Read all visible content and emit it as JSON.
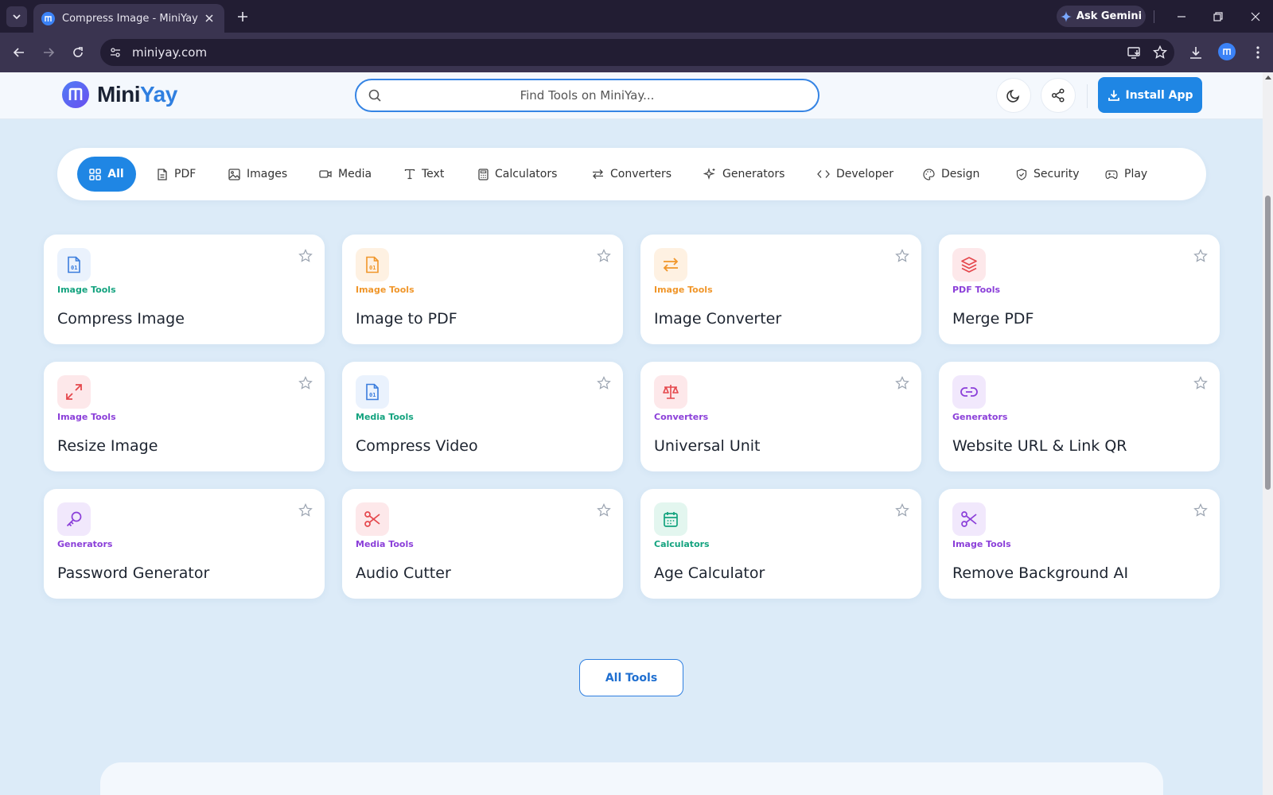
{
  "browser": {
    "tab_title": "Compress Image - MiniYay",
    "url": "miniyay.com",
    "gemini_label": "Ask Gemini"
  },
  "header": {
    "logo_mini": "Mini",
    "logo_yay": "Yay",
    "search_placeholder": "Find Tools on MiniYay...",
    "install_label": "Install App"
  },
  "categories": [
    {
      "label": "All",
      "icon": "grid-icon"
    },
    {
      "label": "PDF",
      "icon": "file-icon"
    },
    {
      "label": "Images",
      "icon": "image-icon"
    },
    {
      "label": "Media",
      "icon": "video-icon"
    },
    {
      "label": "Text",
      "icon": "text-icon"
    },
    {
      "label": "Calculators",
      "icon": "calculator-icon"
    },
    {
      "label": "Converters",
      "icon": "arrows-icon"
    },
    {
      "label": "Generators",
      "icon": "sparkles-icon"
    },
    {
      "label": "Developer",
      "icon": "code-icon"
    },
    {
      "label": "Design",
      "icon": "palette-icon"
    },
    {
      "label": "Security",
      "icon": "shield-icon"
    },
    {
      "label": "Play",
      "icon": "gamepad-icon"
    }
  ],
  "tools": [
    {
      "name": "Compress Image",
      "category": "Image Tools",
      "icon": "binary-file-icon",
      "color": "#3b7ddd",
      "bg": "#eaf2fd",
      "cat_color": "#14a37f"
    },
    {
      "name": "Image to PDF",
      "category": "Image Tools",
      "icon": "binary-file-icon",
      "color": "#f0962a",
      "bg": "#fef1e2",
      "cat_color": "#f0962a"
    },
    {
      "name": "Image Converter",
      "category": "Image Tools",
      "icon": "swap-icon",
      "color": "#f0962a",
      "bg": "#fef1e2",
      "cat_color": "#f0962a"
    },
    {
      "name": "Merge PDF",
      "category": "PDF Tools",
      "icon": "layers-icon",
      "color": "#e5484d",
      "bg": "#fde8ea",
      "cat_color": "#8b3fd9"
    },
    {
      "name": "Resize Image",
      "category": "Image Tools",
      "icon": "expand-icon",
      "color": "#e5484d",
      "bg": "#fde8ea",
      "cat_color": "#8b3fd9"
    },
    {
      "name": "Compress Video",
      "category": "Media Tools",
      "icon": "binary-file-icon",
      "color": "#3b7ddd",
      "bg": "#eaf2fd",
      "cat_color": "#14a37f"
    },
    {
      "name": "Universal Unit",
      "category": "Converters",
      "icon": "scale-icon",
      "color": "#e5484d",
      "bg": "#fde8ea",
      "cat_color": "#8b3fd9"
    },
    {
      "name": "Website URL & Link QR",
      "category": "Generators",
      "icon": "link-icon",
      "color": "#8b3fd9",
      "bg": "#f1e8fc",
      "cat_color": "#8b3fd9"
    },
    {
      "name": "Password Generator",
      "category": "Generators",
      "icon": "key-icon",
      "color": "#8b3fd9",
      "bg": "#f1e8fc",
      "cat_color": "#8b3fd9"
    },
    {
      "name": "Audio Cutter",
      "category": "Media Tools",
      "icon": "scissors-icon",
      "color": "#e5484d",
      "bg": "#fde8ea",
      "cat_color": "#8b3fd9"
    },
    {
      "name": "Age Calculator",
      "category": "Calculators",
      "icon": "calendar-icon",
      "color": "#14a37f",
      "bg": "#e3f6ef",
      "cat_color": "#14a37f"
    },
    {
      "name": "Remove Background AI",
      "category": "Image Tools",
      "icon": "scissors-icon",
      "color": "#8b3fd9",
      "bg": "#f1e8fc",
      "cat_color": "#8b3fd9"
    }
  ],
  "all_tools_label": "All Tools"
}
